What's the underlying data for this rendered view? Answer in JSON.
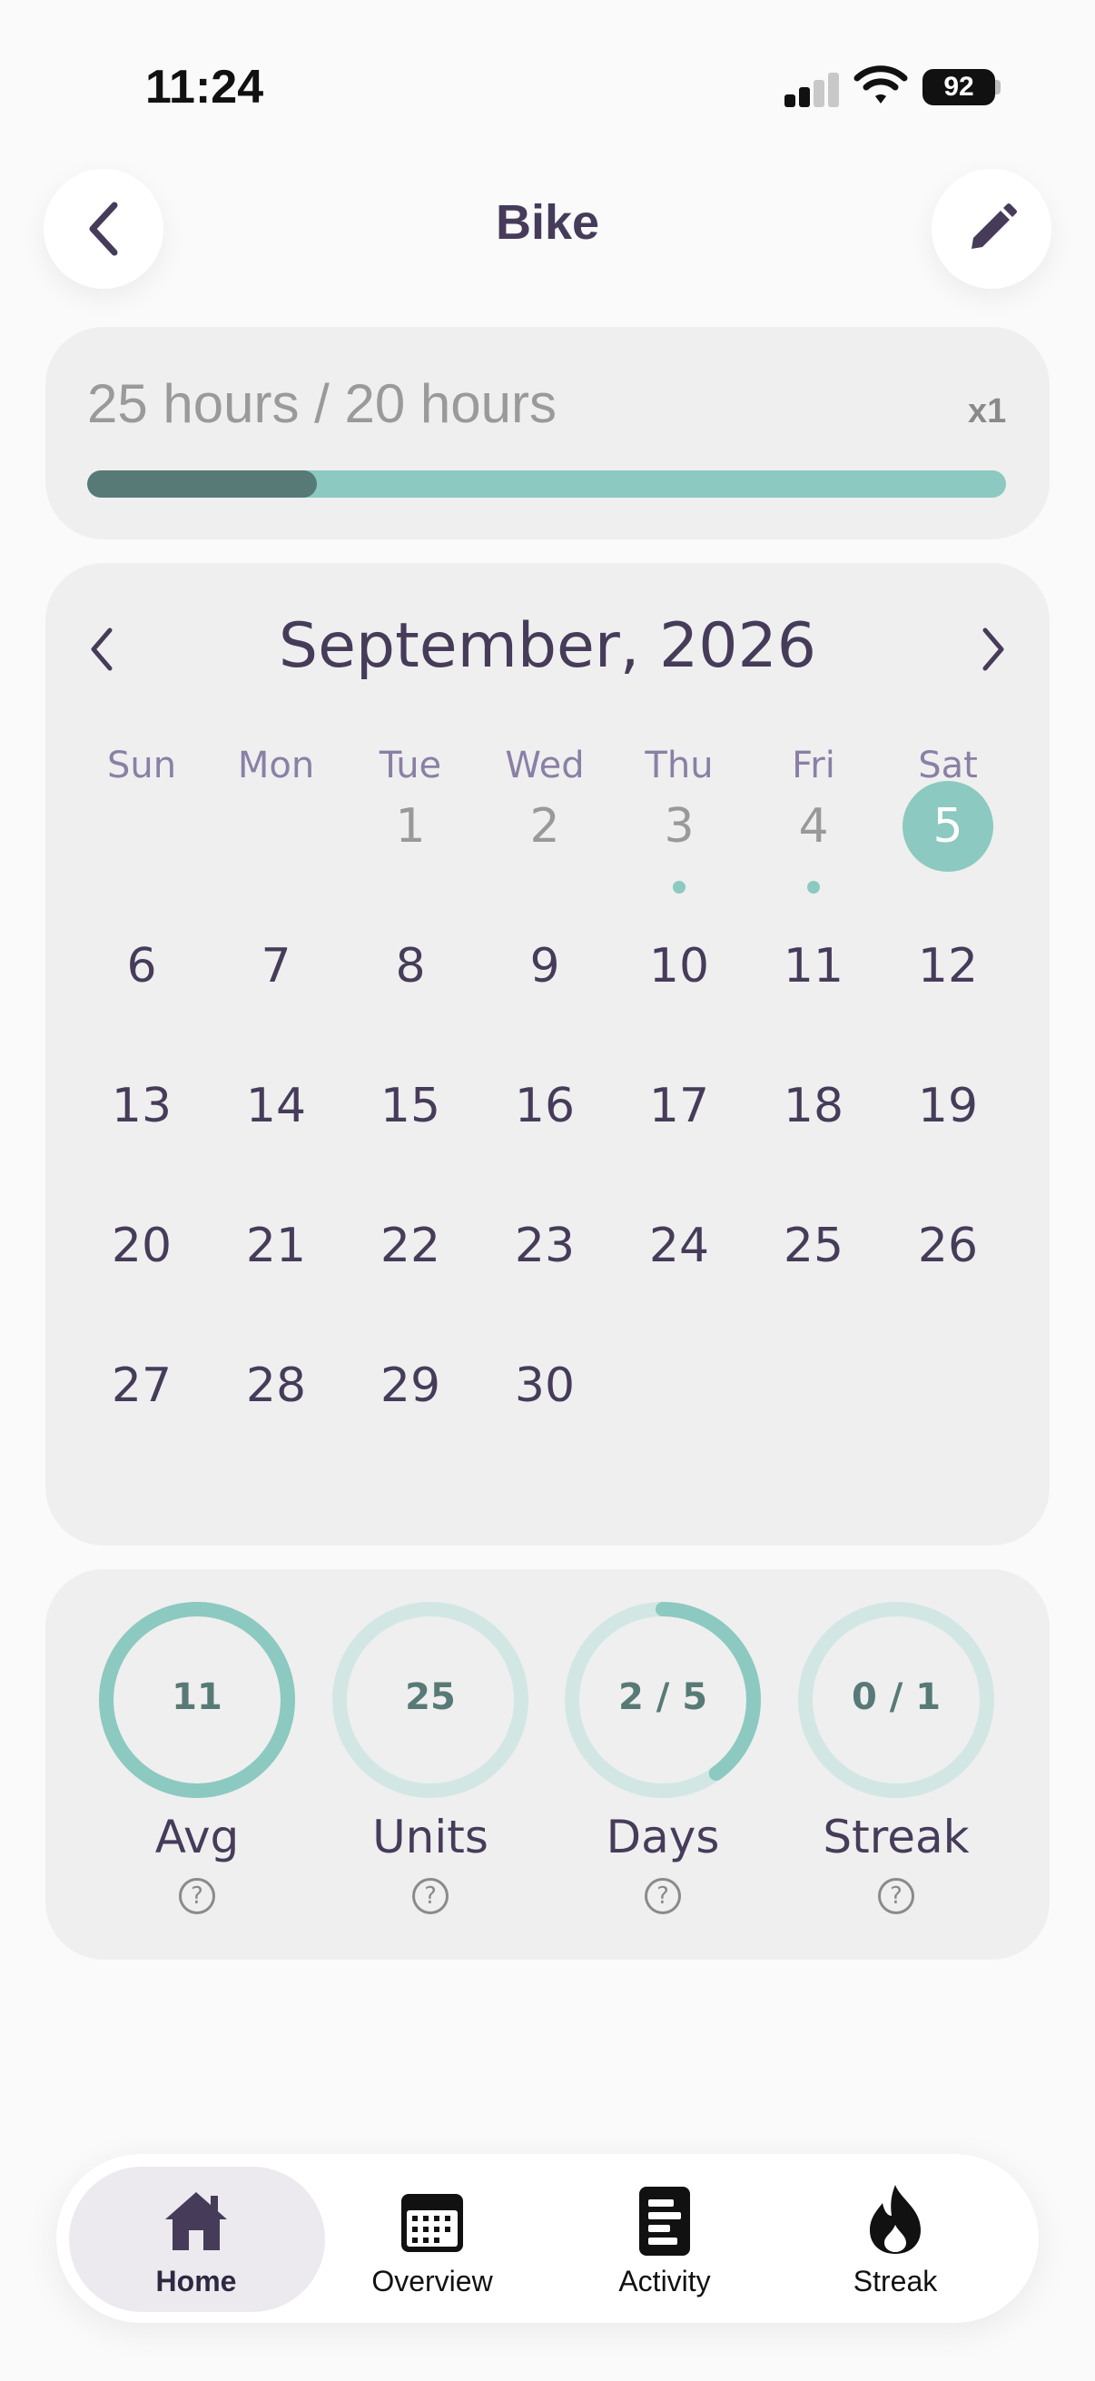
{
  "status_bar": {
    "time": "11:24",
    "battery": "92"
  },
  "header": {
    "title": "Bike"
  },
  "goal": {
    "progress_text": "25 hours / 20 hours",
    "multiplier": "x1",
    "progress_fraction": 0.25
  },
  "calendar": {
    "month_label": "September, 2026",
    "weekdays": [
      "Sun",
      "Mon",
      "Tue",
      "Wed",
      "Thu",
      "Fri",
      "Sat"
    ],
    "days": [
      "1",
      "2",
      "3",
      "4",
      "5",
      "6",
      "7",
      "8",
      "9",
      "10",
      "11",
      "12",
      "13",
      "14",
      "15",
      "16",
      "17",
      "18",
      "19",
      "20",
      "21",
      "22",
      "23",
      "24",
      "25",
      "26",
      "27",
      "28",
      "29",
      "30"
    ],
    "selected_day": "5",
    "days_with_activity": [
      "3",
      "4"
    ]
  },
  "stats": [
    {
      "value": "11",
      "label": "Avg",
      "progress": 1.0
    },
    {
      "value": "25",
      "label": "Units",
      "progress": 0
    },
    {
      "value": "2 / 5",
      "label": "Days",
      "progress": 0.4
    },
    {
      "value": "0 / 1",
      "label": "Streak",
      "progress": 0
    }
  ],
  "nav": {
    "items": [
      {
        "label": "Home",
        "icon": "home-icon",
        "active": true
      },
      {
        "label": "Overview",
        "icon": "calendar-icon",
        "active": false
      },
      {
        "label": "Activity",
        "icon": "list-icon",
        "active": false
      },
      {
        "label": "Streak",
        "icon": "flame-icon",
        "active": false
      }
    ]
  },
  "colors": {
    "accent": "#8cc9c1",
    "accent_dark": "#587a77",
    "ring_track": "#d2e7e4",
    "text": "#463c5a"
  }
}
